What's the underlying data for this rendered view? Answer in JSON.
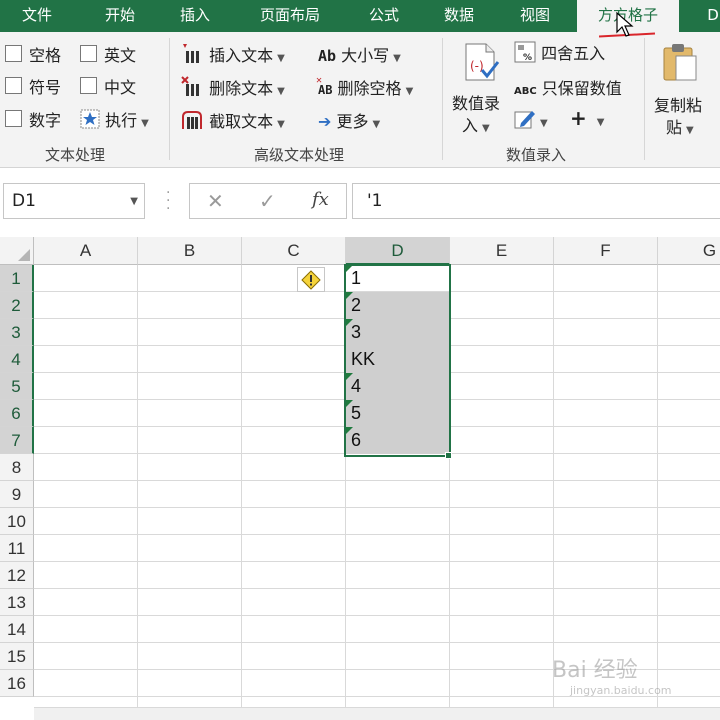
{
  "menu": {
    "tabs": [
      "文件",
      "开始",
      "插入",
      "页面布局",
      "公式",
      "数据",
      "视图",
      "方方格子",
      "D"
    ],
    "active_tab": "方方格子"
  },
  "ribbon": {
    "text_processing": {
      "group_label": "文本处理",
      "checkboxes": [
        "空格",
        "英文",
        "符号",
        "中文",
        "数字"
      ],
      "execute_label": "执行"
    },
    "advanced_text": {
      "group_label": "高级文本处理",
      "insert_text": "插入文本",
      "delete_text": "删除文本",
      "extract_text": "截取文本",
      "case_label": "大小写",
      "delete_space": "删除空格",
      "more": "更多",
      "case_icon_text": "Ab",
      "delete_space_icon_text": "AB"
    },
    "numeric_input": {
      "group_label": "数值录入",
      "numeric_input_line1": "数值录",
      "numeric_input_line2": "入",
      "round": "四舍五入",
      "keep_values": "只保留数值",
      "keep_values_icon_text": "ABC",
      "plus": "+"
    },
    "copy_paste": {
      "line1": "复制粘",
      "line2": "贴"
    }
  },
  "formula_bar": {
    "name_box": "D1",
    "cancel_symbol": "✕",
    "enter_symbol": "✓",
    "fx_symbol": "fx",
    "content": "'1"
  },
  "sheet": {
    "columns": [
      "A",
      "B",
      "C",
      "D",
      "E",
      "F",
      "G"
    ],
    "selected_column": "D",
    "rows": [
      "1",
      "2",
      "3",
      "4",
      "5",
      "6",
      "7",
      "8",
      "9",
      "10",
      "11",
      "12",
      "13",
      "14",
      "15",
      "16"
    ],
    "selected_rows": [
      "1",
      "2",
      "3",
      "4",
      "5",
      "6",
      "7"
    ],
    "column_d_values": [
      "1",
      "2",
      "3",
      "KK",
      "4",
      "5",
      "6"
    ],
    "text_number_flags": [
      true,
      true,
      true,
      false,
      true,
      true,
      true
    ]
  },
  "watermark": {
    "main": "Bai 经验",
    "sub": "jingyan.baidu.com"
  },
  "colors": {
    "excel_green": "#217346",
    "ribbon_bg": "#f3f3f3",
    "selection_fill": "#cfcfcf",
    "underline_red": "#d9252b"
  }
}
